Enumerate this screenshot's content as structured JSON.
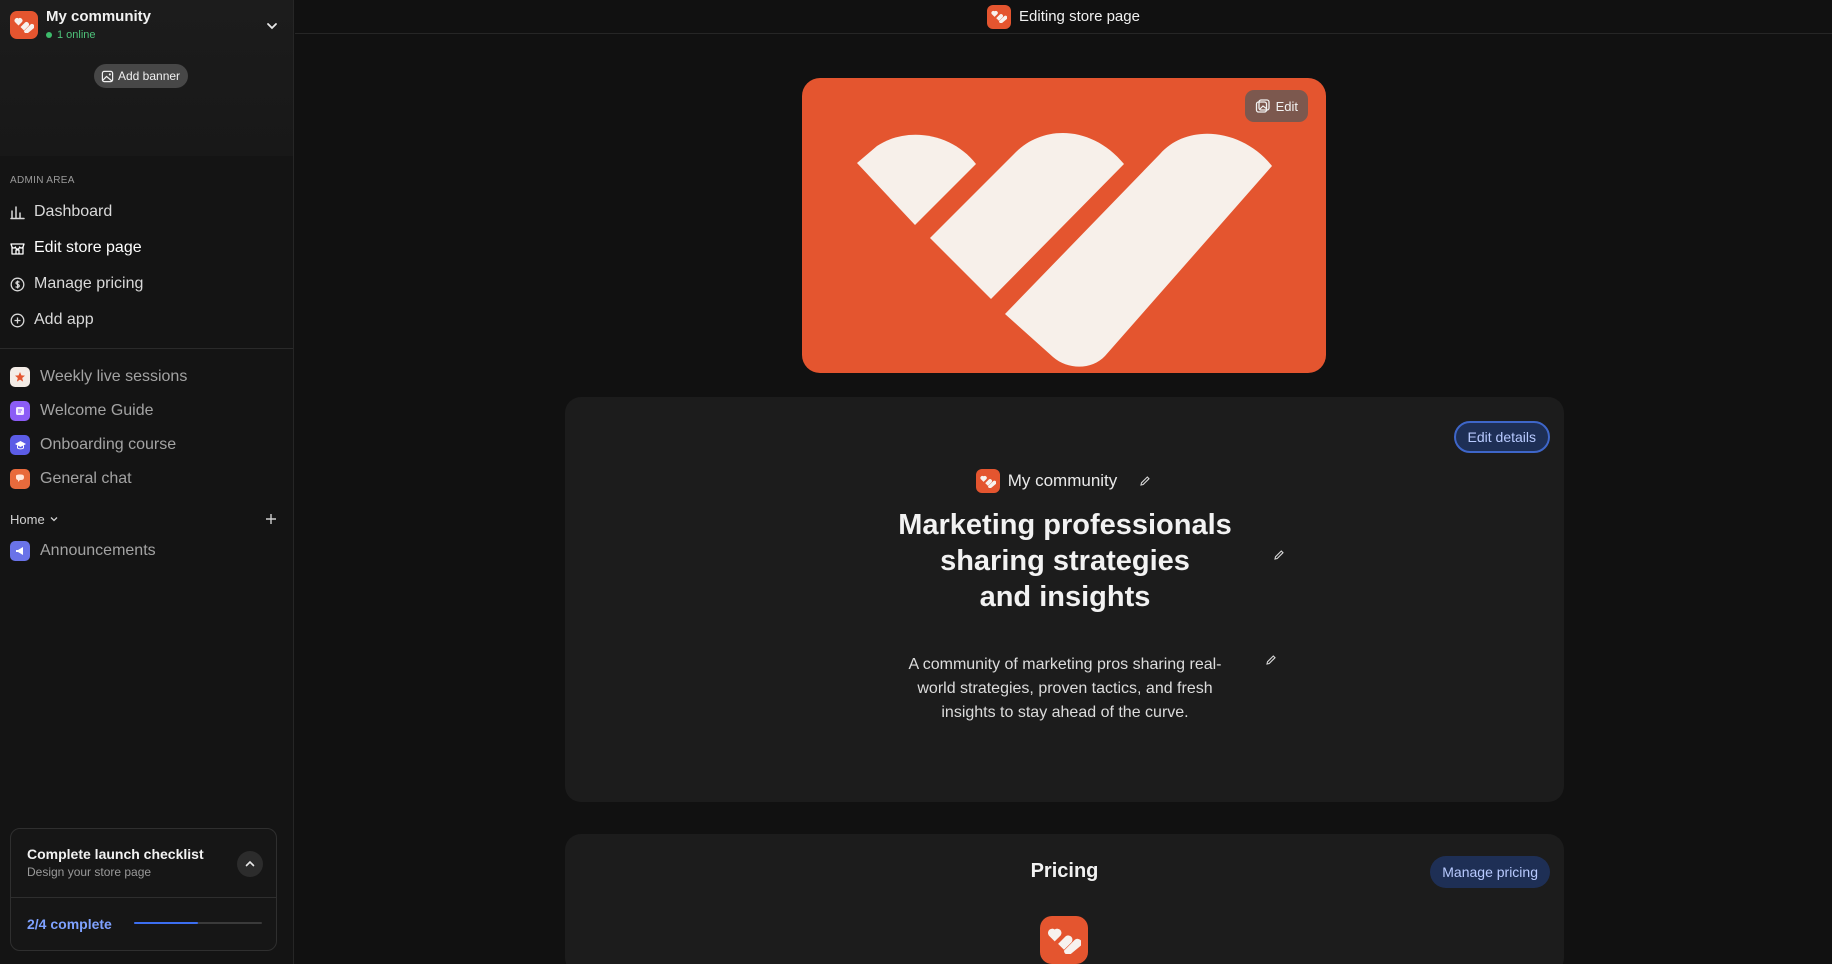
{
  "sidebar": {
    "community_name": "My community",
    "online_text": "1 online",
    "add_banner_label": "Add banner",
    "admin_label": "ADMIN AREA",
    "admin_items": [
      {
        "label": "Dashboard",
        "icon": "chart-bars-icon"
      },
      {
        "label": "Edit store page",
        "icon": "store-icon",
        "active": true
      },
      {
        "label": "Manage pricing",
        "icon": "dollar-circle-icon"
      },
      {
        "label": "Add app",
        "icon": "plus-circle-icon"
      }
    ],
    "apps": [
      {
        "label": "Weekly live sessions",
        "color": "#e4552f"
      },
      {
        "label": "Welcome Guide",
        "color": "#8b5cf6"
      },
      {
        "label": "Onboarding course",
        "color": "#5b5ce6"
      },
      {
        "label": "General chat",
        "color": "#e86a3c"
      }
    ],
    "home_label": "Home",
    "home_apps": [
      {
        "label": "Announcements",
        "color": "#6a73e8"
      }
    ]
  },
  "checklist": {
    "title": "Complete launch checklist",
    "subtitle": "Design your store page",
    "progress_label": "2/4 complete",
    "progress_fraction": 0.5
  },
  "topbar": {
    "title": "Editing store page"
  },
  "hero": {
    "edit_label": "Edit",
    "color": "#e4552f"
  },
  "details": {
    "edit_details_label": "Edit details",
    "community_name": "My community",
    "headline_lines": [
      "Marketing professionals",
      "sharing strategies",
      "and insights"
    ],
    "description": "A community of marketing pros sharing real-world strategies, proven tactics, and fresh insights to stay ahead of the curve."
  },
  "pricing": {
    "title": "Pricing",
    "manage_label": "Manage pricing"
  }
}
